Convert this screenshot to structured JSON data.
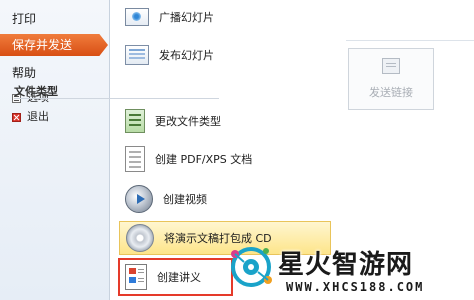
{
  "nav": {
    "print": "打印",
    "save_and_send": "保存并发送",
    "help": "帮助",
    "options": "选项",
    "exit": "退出"
  },
  "middle": {
    "items_top": [
      {
        "label": "广播幻灯片",
        "icon": "broadcast-slides-icon"
      },
      {
        "label": "发布幻灯片",
        "icon": "publish-slides-icon"
      }
    ],
    "section_file_types": "文件类型",
    "items_file_types": [
      {
        "label": "更改文件类型",
        "icon": "change-file-type-icon"
      },
      {
        "label": "创建 PDF/XPS 文档",
        "icon": "pdf-xps-document-icon"
      },
      {
        "label": "创建视频",
        "icon": "video-icon"
      },
      {
        "label": "将演示文稿打包成 CD",
        "icon": "cd-icon"
      },
      {
        "label": "创建讲义",
        "icon": "handout-icon"
      }
    ]
  },
  "right": {
    "send_link_label": "发送链接"
  },
  "watermark": {
    "title": "星火智游网",
    "url": "WWW.XHCS188.COM"
  }
}
